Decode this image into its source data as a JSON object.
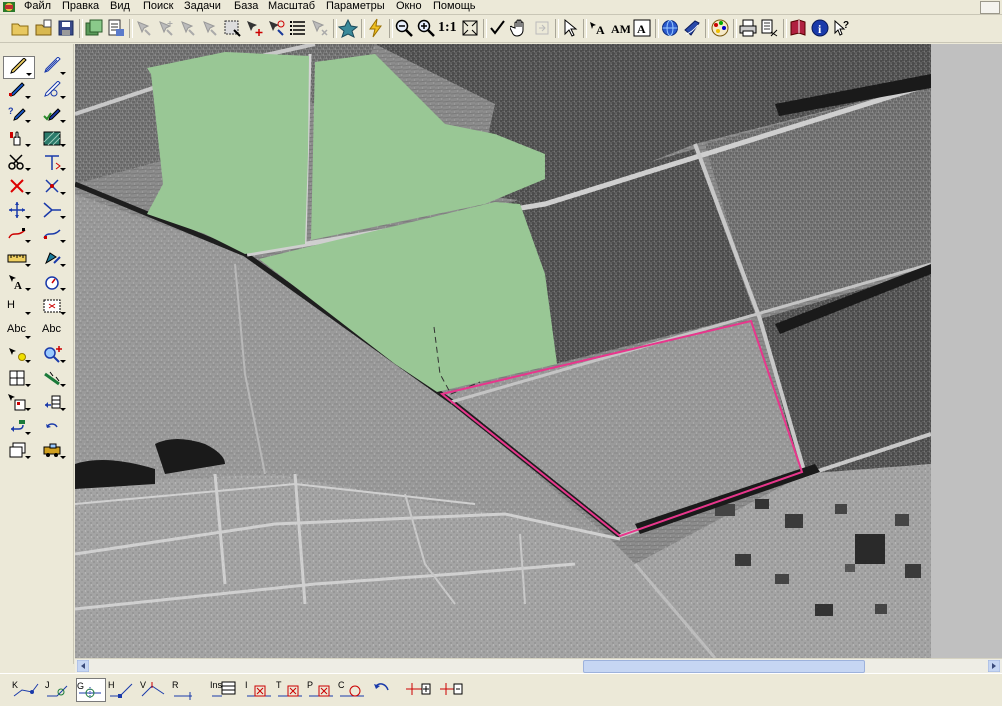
{
  "menu": {
    "items": [
      "Файл",
      "Правка",
      "Вид",
      "Поиск",
      "Задачи",
      "База",
      "Масштаб",
      "Параметры",
      "Окно",
      "Помощь"
    ]
  },
  "toolbar": {
    "scale_label": "1:1"
  },
  "left_tools": {
    "height_label": "H",
    "text_label_1": "Abc",
    "text_label_2": "Abc"
  },
  "bottom_tools": {
    "labels": [
      "K",
      "J",
      "G",
      "H",
      "V",
      "R",
      "Ins",
      "I",
      "T",
      "P",
      "C"
    ]
  },
  "colors": {
    "field_fill": "#99c795",
    "parcel_outline": "#e8368c",
    "accent": "#316ac5"
  }
}
